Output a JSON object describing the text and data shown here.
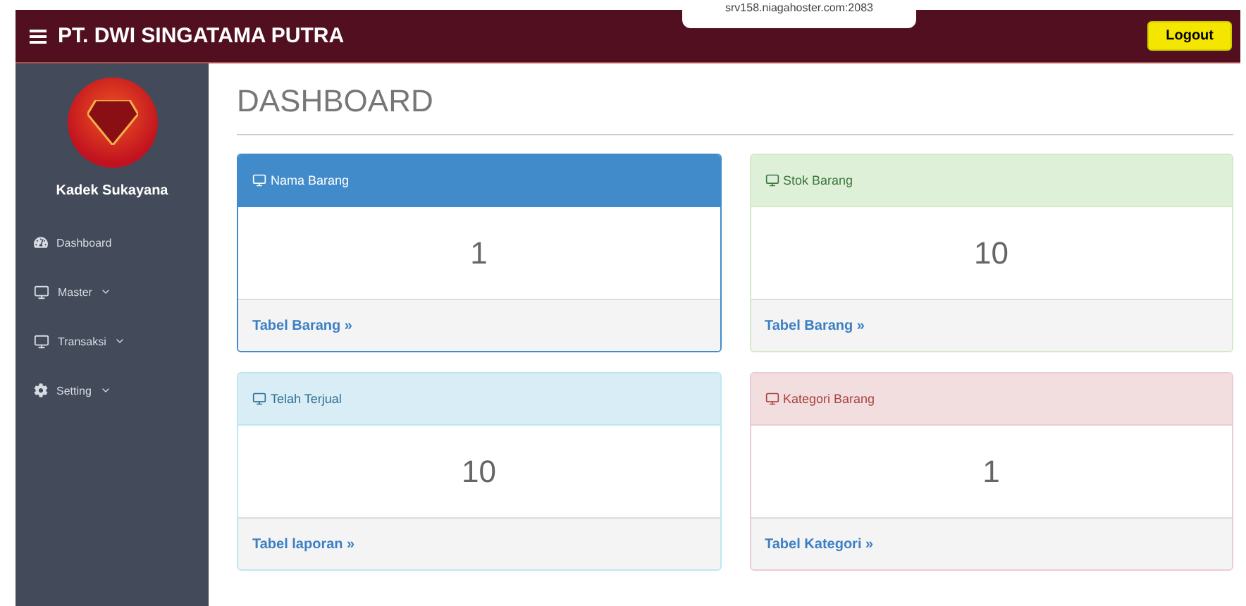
{
  "popup": {
    "text": "srv158.niagahoster.com:2083"
  },
  "topbar": {
    "title": "PT. DWI SINGATAMA PUTRA",
    "logout": "Logout"
  },
  "sidebar": {
    "user": "Kadek Sukayana",
    "items": [
      {
        "label": "Dashboard",
        "has_caret": false
      },
      {
        "label": "Master",
        "has_caret": true
      },
      {
        "label": "Transaksi",
        "has_caret": true
      },
      {
        "label": "Setting",
        "has_caret": true
      }
    ]
  },
  "page_title": "DASHBOARD",
  "panels": [
    {
      "kind": "primary",
      "title": "Nama Barang",
      "value": "1",
      "link": "Tabel Barang »"
    },
    {
      "kind": "success",
      "title": "Stok Barang",
      "value": "10",
      "link": "Tabel Barang »"
    },
    {
      "kind": "info",
      "title": "Telah Terjual",
      "value": "10",
      "link": "Tabel laporan »"
    },
    {
      "kind": "danger",
      "title": "Kategori Barang",
      "value": "1",
      "link": "Tabel Kategori »"
    }
  ]
}
